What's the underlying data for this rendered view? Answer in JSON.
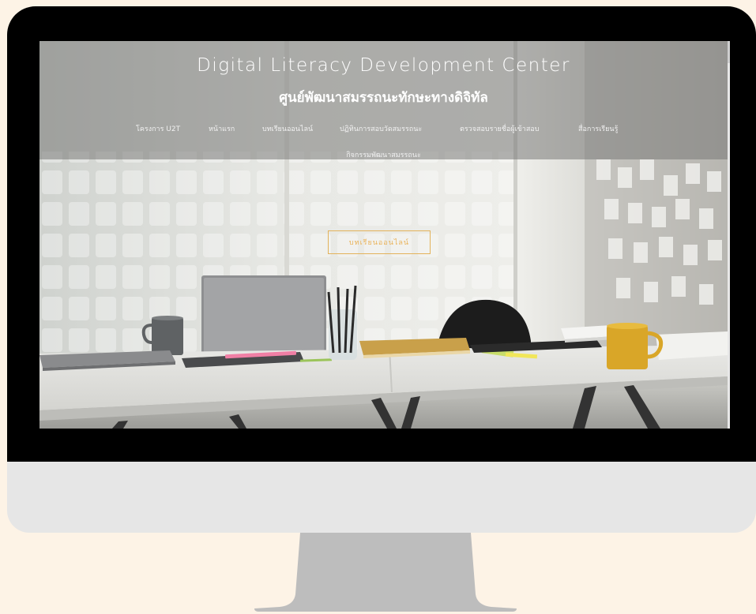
{
  "site": {
    "title_en": "Digital Literacy Development Center",
    "title_th": "ศูนย์พัฒนาสมรรถนะทักษะทางดิจิทัล"
  },
  "nav": {
    "items": [
      {
        "label": "โครงการ U2T"
      },
      {
        "label": "หน้าแรก"
      },
      {
        "label": "บทเรียนออนไลน์"
      },
      {
        "label": "ปฏิทินการสอบวัดสมรรถนะ"
      },
      {
        "label": "ตรวจสอบรายชื่อผู้เข้าสอบ"
      },
      {
        "label": "สื่อการเรียนรู้"
      },
      {
        "label": "กิจกรรมพัฒนาสมรรถนะ"
      }
    ]
  },
  "hero": {
    "cta_label": "บทเรียนออนไลน์"
  },
  "colors": {
    "page_background": "#fdf3e6",
    "bezel": "#000000",
    "chin": "#e6e6e6",
    "stand": "#bdbdbd",
    "cta_accent": "#eab35a",
    "header_overlay": "rgba(120,120,118,0.55)"
  }
}
